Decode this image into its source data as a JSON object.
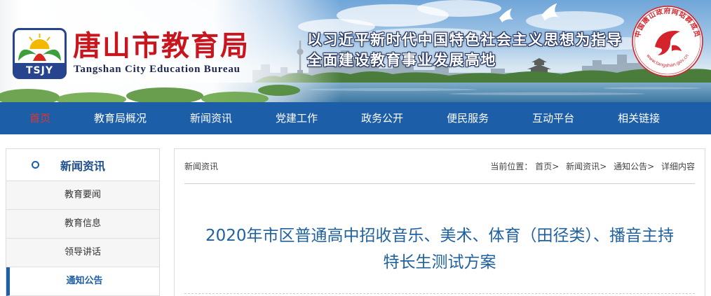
{
  "header": {
    "logo_text": "TSJY",
    "title": "唐山市教育局",
    "subtitle": "Tangshan City Education Bureau",
    "slogan_line1": "以习近平新时代中国特色社会主义思想为指导",
    "slogan_line2": "全面建设教育事业发展高地",
    "seal_text": "中国唐山政府网站群成员",
    "seal_url": "www.tangshan.gov.cn"
  },
  "nav": {
    "items": [
      "首页",
      "教育局概况",
      "新闻资讯",
      "党建工作",
      "政务公开",
      "便民服务",
      "互动平台",
      "相关链接"
    ],
    "active_index": 0
  },
  "sidebar": {
    "title": "新闻资讯",
    "items": [
      "教育要闻",
      "教育信息",
      "领导讲话",
      "通知公告"
    ],
    "active_index": 3
  },
  "content": {
    "section_label": "新闻资讯",
    "location_label": "当前位置：",
    "breadcrumb": [
      "首页",
      "新闻资讯",
      "通知公告",
      "详细内容"
    ],
    "breadcrumb_separator": ">",
    "title_lines": [
      "2020年市区普通高中招收音乐、美术、体育（田径类）、播音主持",
      "特长生测试方案"
    ]
  },
  "colors": {
    "nav_bg": "#1d5ea8",
    "brand_red": "#c9151e",
    "title_blue": "#20619f",
    "active_blue": "#1d5ea6",
    "nav_active": "#e2352d"
  }
}
